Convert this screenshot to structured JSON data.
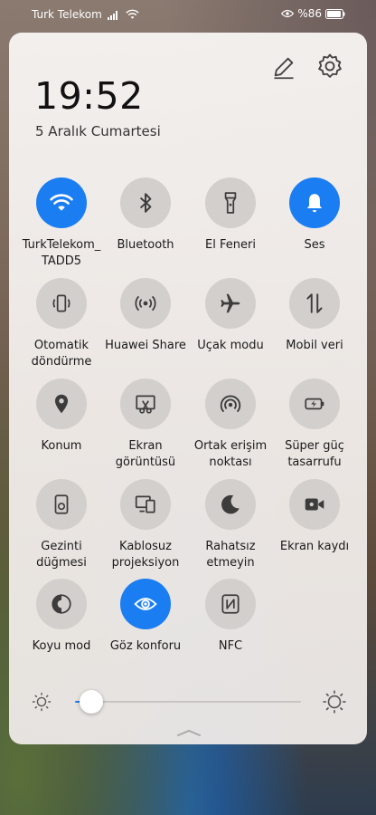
{
  "status": {
    "carrier": "Turk Telekom",
    "battery": "%86"
  },
  "header": {
    "time": "19:52",
    "date": "5 Aralık Cumartesi"
  },
  "tiles": [
    {
      "label": "TurkTelekom_\nTADD5",
      "icon": "wifi-icon",
      "on": true
    },
    {
      "label": "Bluetooth",
      "icon": "bluetooth-icon",
      "on": false
    },
    {
      "label": "El Feneri",
      "icon": "flashlight-icon",
      "on": false
    },
    {
      "label": "Ses",
      "icon": "bell-icon",
      "on": true
    },
    {
      "label": "Otomatik\ndöndürme",
      "icon": "auto-rotate-icon",
      "on": false
    },
    {
      "label": "Huawei Share",
      "icon": "huawei-share-icon",
      "on": false
    },
    {
      "label": "Uçak modu",
      "icon": "airplane-icon",
      "on": false
    },
    {
      "label": "Mobil veri",
      "icon": "mobile-data-icon",
      "on": false
    },
    {
      "label": "Konum",
      "icon": "location-icon",
      "on": false
    },
    {
      "label": "Ekran\ngörüntüsü",
      "icon": "screenshot-icon",
      "on": false
    },
    {
      "label": "Ortak erişim\nnoktası",
      "icon": "hotspot-icon",
      "on": false
    },
    {
      "label": "Süper güç\ntasarrufu",
      "icon": "power-saving-icon",
      "on": false
    },
    {
      "label": "Gezinti\ndüğmesi",
      "icon": "navigation-button-icon",
      "on": false
    },
    {
      "label": "Kablosuz\nprojeksiyon",
      "icon": "wireless-projection-icon",
      "on": false
    },
    {
      "label": "Rahatsız\netmeyin",
      "icon": "moon-icon",
      "on": false
    },
    {
      "label": "Ekran kaydı",
      "icon": "screen-record-icon",
      "on": false
    },
    {
      "label": "Koyu mod",
      "icon": "dark-mode-icon",
      "on": false
    },
    {
      "label": "Göz konforu",
      "icon": "eye-icon",
      "on": true
    },
    {
      "label": "NFC",
      "icon": "nfc-icon",
      "on": false
    }
  ],
  "brightness": {
    "level": 0.07
  },
  "colors": {
    "accent": "#1a7df2",
    "tile_off": "#d3cfcc",
    "icon_off": "#3c3c3c"
  }
}
